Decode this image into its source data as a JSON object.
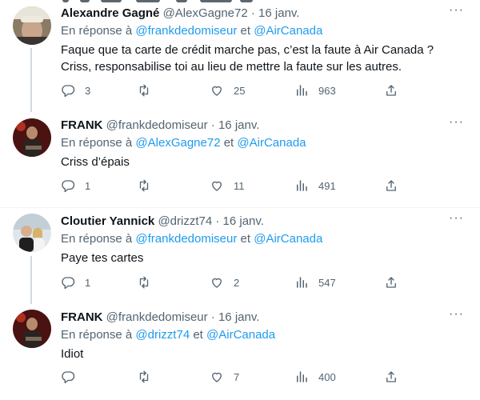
{
  "tweets": [
    {
      "name": "Alexandre Gagné",
      "handle": "@AlexGagne72",
      "dot": "·",
      "date": "16 janv.",
      "more": "···",
      "reply_prefix": "En réponse à",
      "reply_to_1": "@frankdedomiseur",
      "reply_to_2": "@AirCanada",
      "text_line_1": "Faque que ta carte de crédit marche pas, c’est la faute à Air Canada ?",
      "text_line_2": "Criss, responsabilise toi au lieu de mettre la faute sur les autres.",
      "replies": "3",
      "retweets": "",
      "likes": "25",
      "views": "963"
    },
    {
      "name": "FRANK",
      "handle": "@frankdedomiseur",
      "dot": "·",
      "date": "16 janv.",
      "more": "···",
      "reply_prefix": "En réponse à",
      "reply_to_1": "@AlexGagne72",
      "reply_to_2": "@AirCanada",
      "text_line_1": "Criss d’épais",
      "text_line_2": "",
      "replies": "1",
      "retweets": "",
      "likes": "11",
      "views": "491"
    },
    {
      "name": "Cloutier Yannick",
      "handle": "@drizzt74",
      "dot": "·",
      "date": "16 janv.",
      "more": "···",
      "reply_prefix": "En réponse à",
      "reply_to_1": "@frankdedomiseur",
      "reply_to_2": "@AirCanada",
      "text_line_1": "Paye tes cartes",
      "text_line_2": "",
      "replies": "1",
      "retweets": "",
      "likes": "2",
      "views": "547"
    },
    {
      "name": "FRANK",
      "handle": "@frankdedomiseur",
      "dot": "·",
      "date": "16 janv.",
      "more": "···",
      "reply_prefix": "En réponse à",
      "reply_to_1": "@drizzt74",
      "reply_to_2": "@AirCanada",
      "text_line_1": "Idiot",
      "text_line_2": "",
      "replies": "",
      "retweets": "",
      "likes": "7",
      "views": "400"
    }
  ],
  "connector": "et",
  "icons": {
    "reply": "reply-icon",
    "retweet": "retweet-icon",
    "like": "heart-icon",
    "views": "views-icon",
    "share": "share-icon",
    "more": "more-icon"
  },
  "colors": {
    "link": "#1d9bf0",
    "secondary_text": "#536471",
    "primary_text": "#0f1419",
    "thread_line": "#cfd9de",
    "divider": "#eff3f4"
  }
}
